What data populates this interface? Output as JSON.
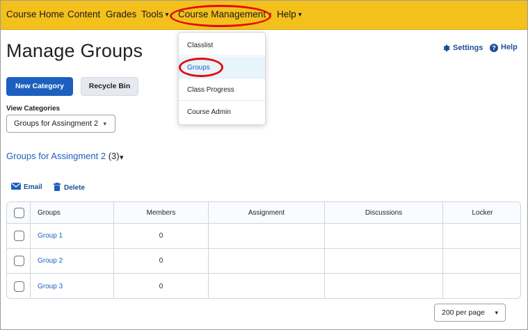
{
  "nav": {
    "course_home": "Course Home",
    "content": "Content",
    "grades": "Grades",
    "tools": "Tools",
    "course_management": "Course Management",
    "help": "Help",
    "chevron": "⌄"
  },
  "page": {
    "title": "Manage Groups",
    "settings": "Settings",
    "help": "Help"
  },
  "buttons": {
    "new_category": "New Category",
    "recycle_bin": "Recycle Bin"
  },
  "view_categories": {
    "label": "View Categories",
    "selected": "Groups for Assingment 2"
  },
  "category": {
    "name": "Groups for Assingment 2",
    "count": "(3)"
  },
  "actions": {
    "email": "Email",
    "delete": "Delete"
  },
  "table": {
    "headers": [
      "Groups",
      "Members",
      "Assignment",
      "Discussions",
      "Locker"
    ],
    "rows": [
      {
        "group": "Group 1",
        "members": "0",
        "assignment": "",
        "discussions": "",
        "locker": ""
      },
      {
        "group": "Group 2",
        "members": "0",
        "assignment": "",
        "discussions": "",
        "locker": ""
      },
      {
        "group": "Group 3",
        "members": "0",
        "assignment": "",
        "discussions": "",
        "locker": ""
      }
    ]
  },
  "pagination": {
    "per_page": "200 per page"
  },
  "dropdown": {
    "items": [
      "Classlist",
      "Groups",
      "Class Progress",
      "Course Admin"
    ],
    "active": "Groups"
  },
  "colors": {
    "navbar": "#f4c01c",
    "primary": "#1c5fbf",
    "highlight": "#e30b0b"
  }
}
